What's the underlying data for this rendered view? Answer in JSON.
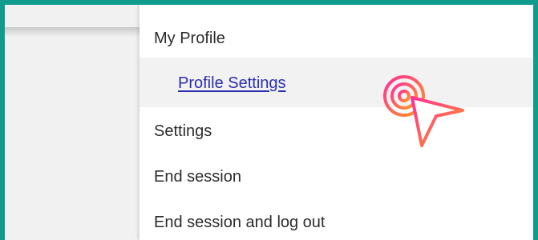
{
  "menu": {
    "items": [
      {
        "label": "My Profile"
      },
      {
        "label": "Profile Settings",
        "highlighted": true
      },
      {
        "label": "Settings"
      },
      {
        "label": "End session"
      },
      {
        "label": "End session and log out"
      }
    ]
  },
  "icons": {
    "cursor": "click-cursor-icon"
  },
  "colors": {
    "frame_border": "#0f9c8c",
    "link": "#2d2db0",
    "highlight_bg": "#f2f2f2",
    "cursor_gradient_start": "#ff2e9a",
    "cursor_gradient_end": "#ff9a1f"
  }
}
